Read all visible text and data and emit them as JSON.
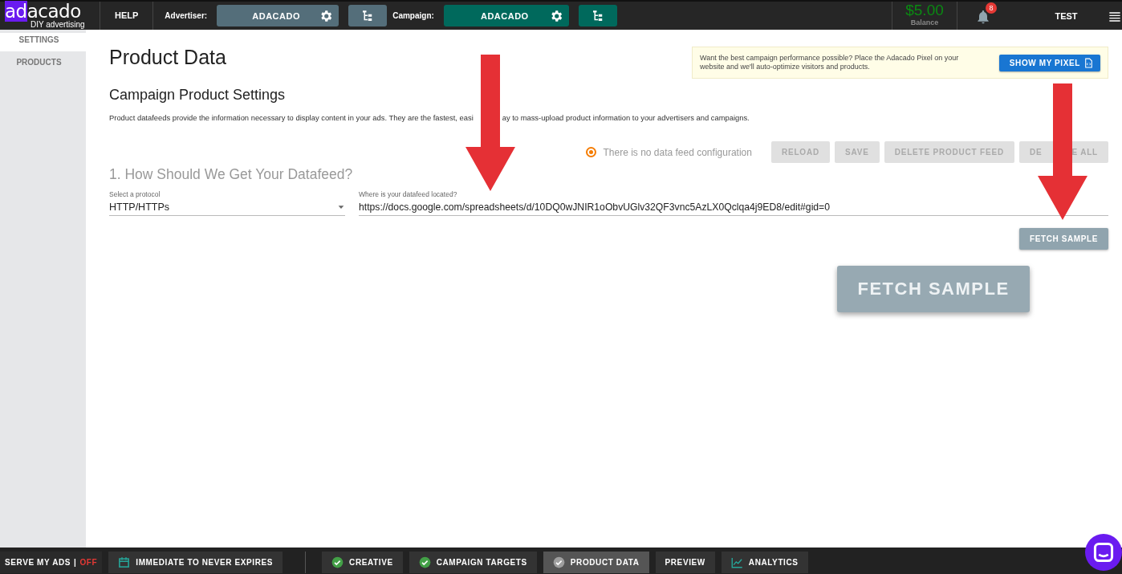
{
  "topbar": {
    "logo": {
      "highlight": "ad",
      "rest": "acado",
      "tagline": "DIY advertising"
    },
    "help": "HELP",
    "advertiser": {
      "label": "Advertiser:",
      "value": "ADACADO"
    },
    "campaign": {
      "label": "Campaign:",
      "value": "ADACADO"
    },
    "balance": {
      "amount": "$5.00",
      "label": "Balance"
    },
    "notifications": "8",
    "user": "TEST"
  },
  "sidebar": {
    "items": [
      {
        "label": "SETTINGS",
        "selected": true
      },
      {
        "label": "PRODUCTS",
        "selected": false
      }
    ]
  },
  "page": {
    "title": "Product Data",
    "pixel_notice": {
      "text": "Want the best campaign performance possible? Place the Adacado Pixel on your website and we'll auto-optimize visitors and products.",
      "button": "SHOW MY PIXEL"
    },
    "section_title": "Campaign Product Settings",
    "description": [
      "Product datafeeds provide the information necessary to display content in your ads. They are the fastest, easi",
      "ay to mass-upload product information to your advertisers and campaigns."
    ],
    "status": {
      "text": "There is no data feed configuration",
      "selected": true
    },
    "actions": [
      {
        "label": "RELOAD",
        "disabled": true
      },
      {
        "label": "SAVE",
        "disabled": true
      },
      {
        "label": "DELETE PRODUCT FEED",
        "disabled": true
      },
      {
        "label": "DE",
        "label_after": "E ALL",
        "disabled": true
      }
    ],
    "step_title": "1. How Should We Get Your Datafeed?",
    "protocol": {
      "label": "Select a protocol",
      "value": "HTTP/HTTPs"
    },
    "location": {
      "label": "Where is your datafeed located?",
      "value": "https://docs.google.com/spreadsheets/d/10DQ0wJNIR1oObvUGlv32QF3vnc5AzLX0Qclqa4j9ED8/edit#gid=0"
    },
    "fetch_button": "FETCH SAMPLE",
    "callout": "FETCH SAMPLE"
  },
  "bottombar": {
    "serve": {
      "label": "SERVE MY ADS",
      "separator": "|",
      "state": "OFF"
    },
    "schedule": "IMMEDIATE TO NEVER EXPIRES",
    "tabs": [
      {
        "label": "CREATIVE",
        "kind": "check",
        "done": true,
        "selected": false
      },
      {
        "label": "CAMPAIGN TARGETS",
        "kind": "check",
        "done": true,
        "selected": false
      },
      {
        "label": "PRODUCT DATA",
        "kind": "check",
        "done": false,
        "selected": true
      },
      {
        "label": "PREVIEW",
        "kind": "plain",
        "selected": false
      },
      {
        "label": "ANALYTICS",
        "kind": "chart",
        "selected": false
      }
    ]
  }
}
